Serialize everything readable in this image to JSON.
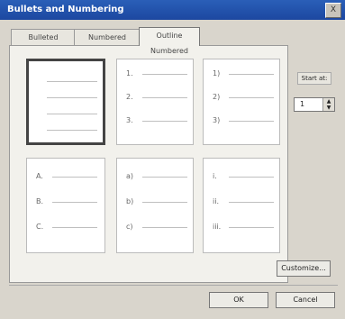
{
  "window": {
    "title": "Bullets and Numbering",
    "close_glyph": "X"
  },
  "tabs": [
    {
      "label": "Bulleted"
    },
    {
      "label": "Numbered"
    },
    {
      "label": "Outline Numbered"
    }
  ],
  "presets": [
    {
      "selected": true,
      "markers": []
    },
    {
      "selected": false,
      "markers": [
        "1.",
        "2.",
        "3."
      ]
    },
    {
      "selected": false,
      "markers": [
        "1)",
        "2)",
        "3)"
      ]
    },
    {
      "selected": false,
      "markers": [
        "A.",
        "B.",
        "C."
      ]
    },
    {
      "selected": false,
      "markers": [
        "a)",
        "b)",
        "c)"
      ]
    },
    {
      "selected": false,
      "markers": [
        "i.",
        "ii.",
        "iii."
      ]
    }
  ],
  "side": {
    "label": "Start at:",
    "start_value": "1",
    "spin_up": "▲",
    "spin_down": "▼"
  },
  "buttons": {
    "customize": "Customize...",
    "ok": "OK",
    "cancel": "Cancel"
  }
}
